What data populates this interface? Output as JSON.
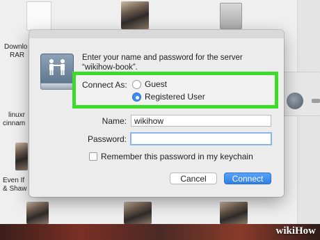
{
  "finder": {
    "labels": {
      "download_rar_1": "Downlo",
      "download_rar_2": "RAR",
      "linux_1": "linuxr",
      "linux_2": "cinnam",
      "evenif_1": "Even If",
      "evenif_2": "& Shaw"
    }
  },
  "dialog": {
    "prompt_line1": "Enter your name and password for the server",
    "prompt_line2": "“wikihow-book”.",
    "connect_as_label": "Connect As:",
    "guest_label": "Guest",
    "registered_label": "Registered User",
    "selected_option": "Registered User",
    "name_label": "Name:",
    "name_value": "wikihow",
    "password_label": "Password:",
    "password_value": "",
    "remember_label": "Remember this password in my keychain",
    "cancel_label": "Cancel",
    "connect_label": "Connect"
  },
  "colors": {
    "highlight": "#3ddc2a",
    "accent": "#2f7fe3"
  },
  "watermark": "wikiHow"
}
